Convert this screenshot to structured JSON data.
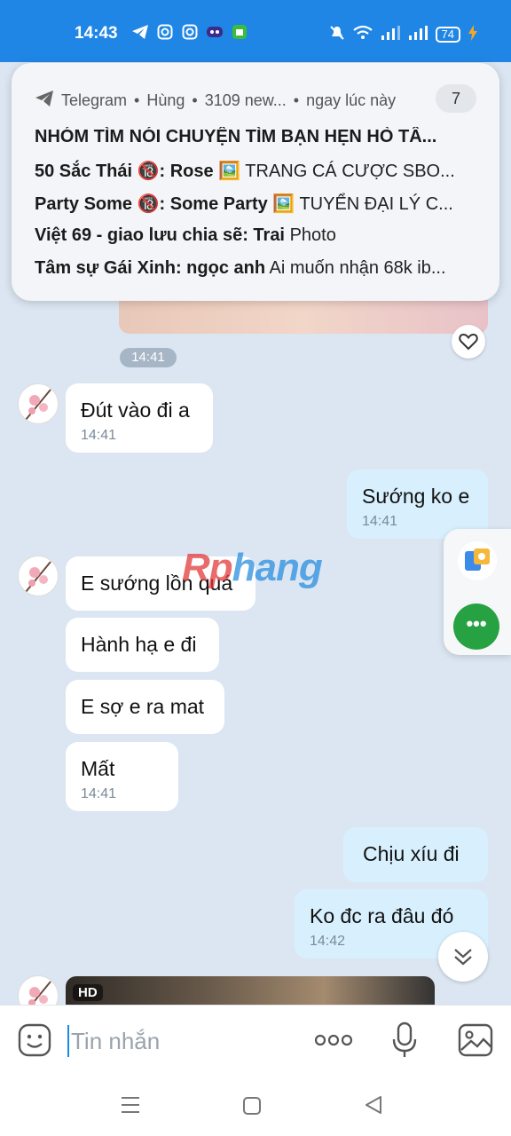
{
  "status": {
    "time": "14:43",
    "battery": "74"
  },
  "notification": {
    "app": "Telegram",
    "sender": "Hùng",
    "summary": "3109 new...",
    "when": "ngay lúc này",
    "count": "7",
    "lines": [
      {
        "title": "NHÓM TÌM NÓI CHUYỆN TÌM BẠN HẸN HÒ TÂ...",
        "text": ""
      },
      {
        "title": "50 Sắc Thái 🔞: Rose",
        "text": "🖼️ TRANG CÁ CƯỢC SBO..."
      },
      {
        "title": "Party Some 🔞: Some Party",
        "text": "🖼️ TUYỂN ĐẠI LÝ C..."
      },
      {
        "title": "Việt 69 - giao lưu chia sẽ: Trai",
        "text": "Photo"
      },
      {
        "title": "Tâm sự Gái Xinh: ngọc anh",
        "text": "Ai muốn nhận 68k ib..."
      }
    ]
  },
  "chat": {
    "image_time": "14:41",
    "messages": [
      {
        "text": "Đút vào đi a",
        "time": "14:41"
      },
      {
        "text": "Sướng ko e",
        "time": "14:41"
      },
      {
        "text": "E sướng lồn quá",
        "time": ""
      },
      {
        "text": "Hành hạ e đi",
        "time": ""
      },
      {
        "text": "E sợ e ra mat",
        "time": ""
      },
      {
        "text": "Mất",
        "time": "14:41"
      },
      {
        "text": "Chịu xíu đi",
        "time": ""
      },
      {
        "text": "Ko đc ra đâu đó",
        "time": "14:42"
      }
    ],
    "hd_label": "HD"
  },
  "watermark": {
    "part1": "Rp",
    "part2": "hang"
  },
  "input": {
    "placeholder": "Tin nhắn"
  },
  "colors": {
    "accent": "#1f86e5",
    "outgoing": "#d8f0fe",
    "incoming": "#ffffff",
    "more_button": "#27a243"
  }
}
